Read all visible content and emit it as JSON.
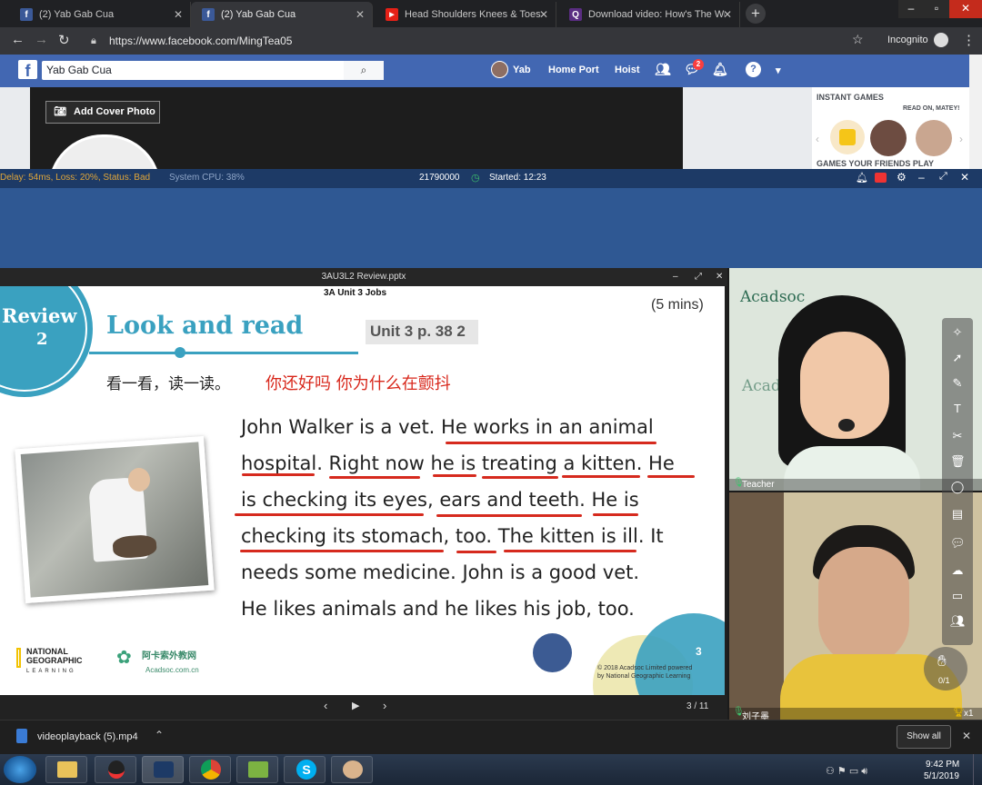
{
  "browser": {
    "tabs": [
      {
        "title": "(2) Yab Gab Cua",
        "icon": "facebook-icon",
        "active": false
      },
      {
        "title": "(2) Yab Gab Cua",
        "icon": "facebook-icon",
        "active": true
      },
      {
        "title": "Head Shoulders Knees & Toes | C",
        "icon": "youtube-icon",
        "active": false
      },
      {
        "title": "Download video: How's The We",
        "icon": "q-icon",
        "active": false
      }
    ],
    "url": "https://www.facebook.com/MingTea05",
    "profile_label": "Incognito"
  },
  "facebook": {
    "search_value": "Yab Gab Cua",
    "user_name": "Yab",
    "nav": [
      "Home Port",
      "Hoist"
    ],
    "messenger_badge": "2",
    "add_cover_label": "Add Cover Photo",
    "games_header": "INSTANT GAMES",
    "games_tagline": "READ ON, MATEY!",
    "games_footer": "GAMES YOUR FRIENDS PLAY"
  },
  "classroom": {
    "status_text": "Delay: 54ms, Loss: 20%, Status: Bad",
    "cpu_text": "System CPU: 38%",
    "room_id": "21790000",
    "started_text": "Started: 12:23",
    "file_title": "3AU3L2 Review.pptx",
    "page_indicator": "3 / 11",
    "teacher_label": "Teacher",
    "student_label": "刘子墨",
    "student_count": "x1",
    "hand_counter": "0/1",
    "teacher_logo": "Acadsoc"
  },
  "slide": {
    "subtitle": "3A Unit 3 Jobs",
    "timer": "(5 mins)",
    "badge_top": "Review",
    "badge_num": "2",
    "heading": "Look and read",
    "unit_ref": "Unit 3 p. 38  2",
    "chinese_prompt": "看一看，读一读。",
    "chinese_annotation": "你还好吗 你为什么在颤抖",
    "lines": [
      "John Walker is a vet. He works in an animal",
      "hospital. Right now he is treating a kitten. He",
      "is checking its eyes, ears and teeth. He is",
      "checking its stomach, too. The kitten is ill. It",
      "needs some medicine. John is a good vet.",
      "He likes animals and he likes his job, too."
    ],
    "natgeo_line1": "NATIONAL",
    "natgeo_line2": "GEOGRAPHIC",
    "natgeo_line3": "LEARNING",
    "acadsoc_cn": "阿卡索外教网",
    "acadsoc_url": "Acadsoc.com.cn",
    "page_number": "3",
    "copyright1": "© 2018 Acadsoc Limited powered",
    "copyright2": "by National Geographic Learning"
  },
  "downloads": {
    "file_name": "videoplayback (5).mp4",
    "show_all": "Show all"
  },
  "taskbar": {
    "time": "9:42 PM",
    "date": "5/1/2019"
  },
  "colors": {
    "facebook_blue": "#4267b2",
    "slide_teal": "#3aa1c0",
    "underline_red": "#d62a1e",
    "annotation_red": "#d8281c"
  }
}
